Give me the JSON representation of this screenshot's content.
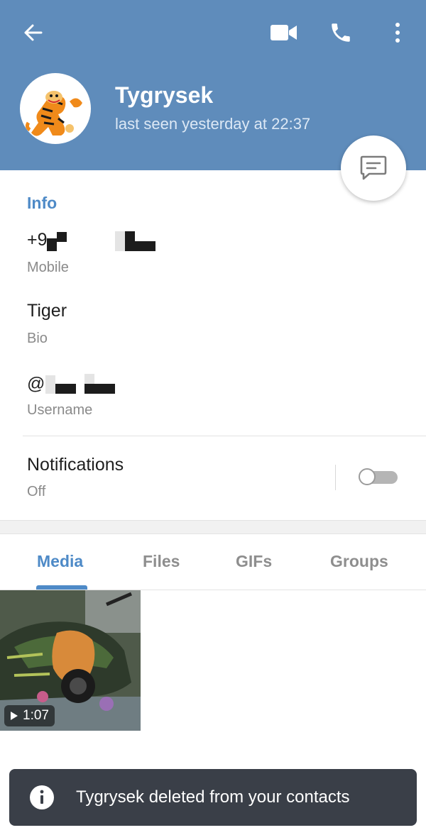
{
  "header": {
    "name": "Tygrysek",
    "status": "last seen yesterday at 22:37",
    "bg_color": "#5f8cbb",
    "icons": [
      "back-arrow-icon",
      "video-call-icon",
      "phone-icon",
      "more-vertical-icon"
    ]
  },
  "info": {
    "section_title": "Info",
    "phone_prefix": "+9",
    "phone_label": "Mobile",
    "bio_value": "Tiger",
    "bio_label": "Bio",
    "username_prefix": "@",
    "username_label": "Username"
  },
  "notifications": {
    "title": "Notifications",
    "value": "Off",
    "enabled": false
  },
  "tabs": [
    {
      "label": "Media",
      "active": true
    },
    {
      "label": "Files",
      "active": false
    },
    {
      "label": "GIFs",
      "active": false
    },
    {
      "label": "Groups",
      "active": false
    }
  ],
  "media": {
    "items": [
      {
        "type": "video",
        "duration": "1:07"
      }
    ]
  },
  "toast": {
    "message": "Tygrysek deleted from your contacts",
    "icon": "info-icon"
  },
  "colors": {
    "accent": "#4e8ac7",
    "toast_bg": "#3a3f48"
  }
}
